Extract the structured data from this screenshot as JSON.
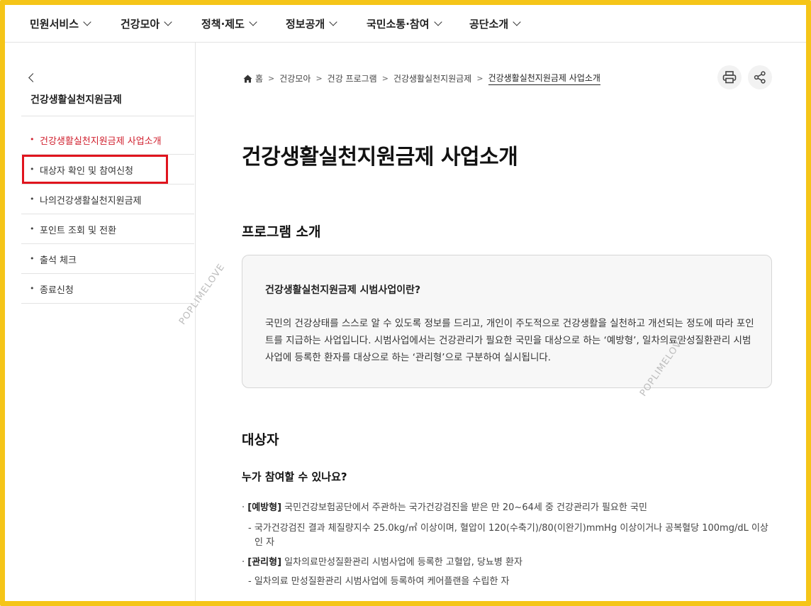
{
  "nav": {
    "items": [
      {
        "label": "민원서비스"
      },
      {
        "label": "건강모아"
      },
      {
        "label": "정책·제도"
      },
      {
        "label": "정보공개"
      },
      {
        "label": "국민소통·참여"
      },
      {
        "label": "공단소개"
      }
    ]
  },
  "sidebar": {
    "title": "건강생활실천지원금제",
    "items": [
      {
        "label": "건강생활실천지원금제 사업소개",
        "active": true
      },
      {
        "label": "대상자 확인 및 참여신청"
      },
      {
        "label": "나의건강생활실천지원금제"
      },
      {
        "label": "포인트 조회 및 전환"
      },
      {
        "label": "출석 체크"
      },
      {
        "label": "종료신청"
      }
    ],
    "bullet": "•"
  },
  "breadcrumb": {
    "home": "홈",
    "items": [
      "건강모아",
      "건강 프로그램",
      "건강생활실천지원금제"
    ],
    "current": "건강생활실천지원금제 사업소개",
    "sep": ">"
  },
  "main": {
    "title": "건강생활실천지원금제 사업소개",
    "section1": "프로그램 소개",
    "box_title": "건강생활실천지원금제 시범사업이란?",
    "box_body": "국민의 건강상태를 스스로 알 수 있도록 정보를 드리고, 개인이 주도적으로 건강생활을 실천하고 개선되는 정도에 따라 포인트를 지급하는 사업입니다. 시범사업에서는 건강관리가 필요한 국민을 대상으로 하는 ‘예방형’, 일차의료만성질환관리 시범사업에 등록한 환자를 대상으로 하는 ‘관리형’으로 구분하여 실시됩니다.",
    "section2": "대상자",
    "sub_title": "누가 참여할 수 있나요?",
    "list": {
      "b1_tag": "[예방형]",
      "b1_text": " 국민건강보험공단에서 주관하는 국가건강검진을 받은 만 20~64세 중 건강관리가 필요한 국민",
      "b1_sub_1": "- 국가건강검진 결과 체질량지수 25.0kg/㎡ 이상이며, 혈압이 120(수축기)/80(이완기)mmHg 이상이거나 공복혈당 100mg/dL 이상",
      "b1_sub_2": "인 자",
      "b2_tag": "[관리형]",
      "b2_text": " 일차의료만성질환관리 시범사업에 등록한 고혈압, 당뇨병 환자",
      "b2_sub": "- 일차의료 만성질환관리 시범사업에 등록하여 케어플랜을 수립한 자",
      "dot": "·"
    }
  },
  "watermark": "POPLIMELOVE",
  "colors": {
    "frame": "#f5c518",
    "active": "#d0202e",
    "highlight_box": "#e0141e"
  }
}
